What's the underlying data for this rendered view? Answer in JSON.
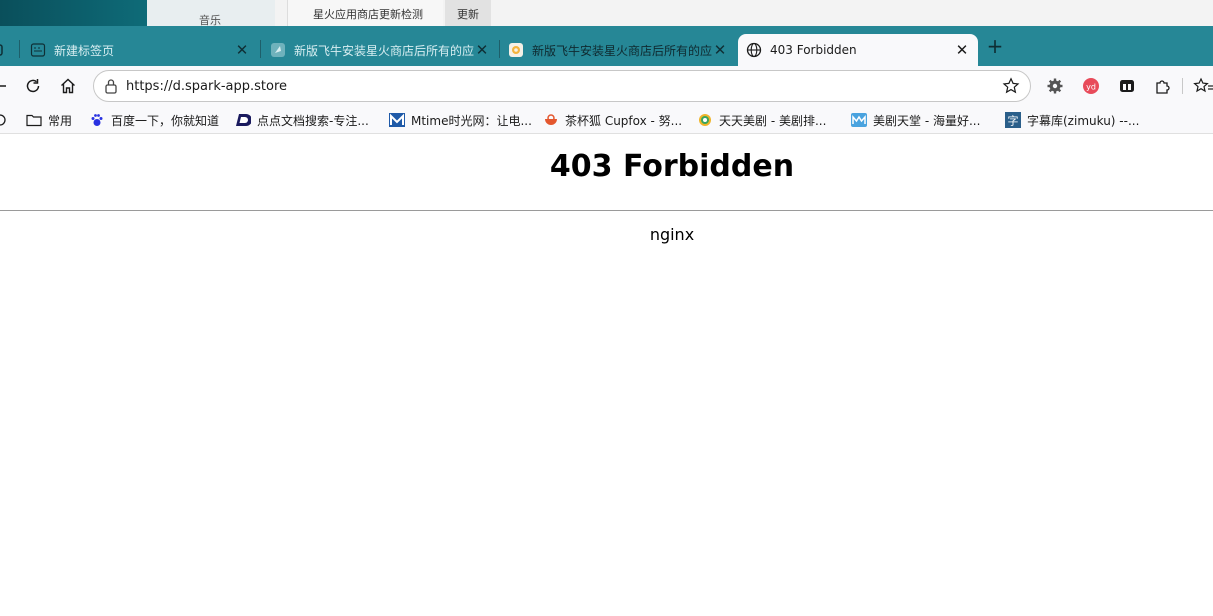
{
  "background_app": {
    "music_label": "音乐",
    "window_title": "星火应用商店更新检测",
    "update_label": "更新"
  },
  "tabs": [
    {
      "title": "新建标签页",
      "icon": "new-tab-page-icon",
      "active": false
    },
    {
      "title": "新版飞牛安装星火商店后所有的应用",
      "icon": "feiniu-icon",
      "active": false
    },
    {
      "title": "新版飞牛安装星火商店后所有的应用",
      "icon": "spark-store-icon",
      "active": false
    },
    {
      "title": "403 Forbidden",
      "icon": "globe-icon",
      "active": true
    }
  ],
  "address_bar": {
    "url": "https://d.spark-app.store"
  },
  "bookmarks": [
    {
      "label": "常用",
      "icon": "folder-icon"
    },
    {
      "label": "百度一下，你就知道",
      "icon": "baidu-icon"
    },
    {
      "label": "点点文档搜索-专注...",
      "icon": "diandian-icon"
    },
    {
      "label": "Mtime时光网：让电...",
      "icon": "mtime-icon"
    },
    {
      "label": "茶杯狐 Cupfox - 努...",
      "icon": "cupfox-icon"
    },
    {
      "label": "天天美剧 - 美剧排...",
      "icon": "tiantian-icon"
    },
    {
      "label": "美剧天堂 - 海量好...",
      "icon": "meiju-icon"
    },
    {
      "label": "字幕库(zimuku) --...",
      "icon": "zimuku-icon"
    }
  ],
  "page": {
    "heading": "403 Forbidden",
    "server": "nginx"
  },
  "colors": {
    "tabbar": "#268796",
    "toolbar": "#f9f9fb"
  }
}
